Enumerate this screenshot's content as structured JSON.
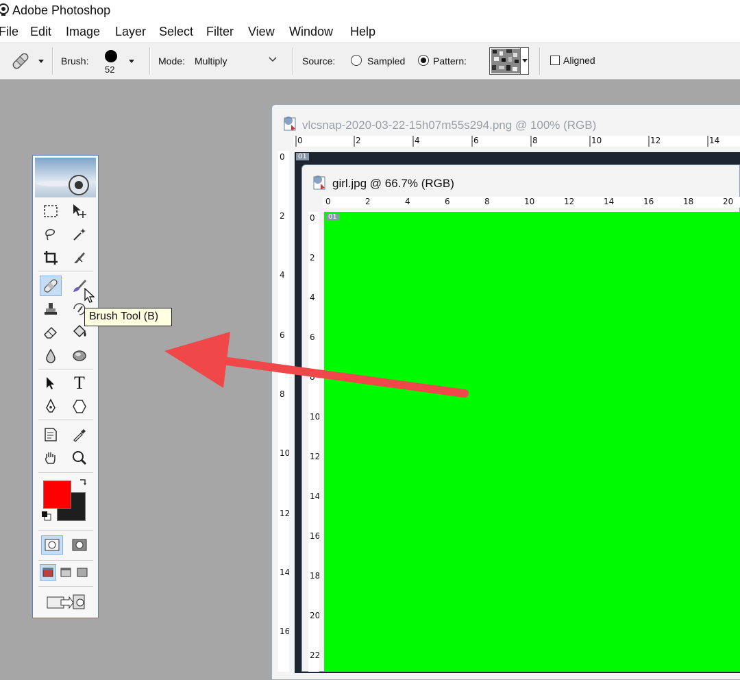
{
  "app": {
    "title": "Adobe Photoshop"
  },
  "menu": [
    "File",
    "Edit",
    "Image",
    "Layer",
    "Select",
    "Filter",
    "View",
    "Window",
    "Help"
  ],
  "options": {
    "brush_label": "Brush:",
    "brush_size": "52",
    "mode_label": "Mode:",
    "mode_value": "Multiply",
    "source_label": "Source:",
    "sampled_label": "Sampled",
    "pattern_label": "Pattern:",
    "source_selected": "Pattern",
    "aligned_label": "Aligned",
    "aligned_checked": false
  },
  "toolbox": {
    "tooltip": "Brush Tool (B)",
    "foreground_color": "#ff0000",
    "background_color": "#1e1e1e"
  },
  "documents": [
    {
      "title": "vlcsnap-2020-03-22-15h07m55s294.png @ 100% (RGB)",
      "layer_tag": "01",
      "ruler_h": [
        "0",
        "2",
        "4",
        "6",
        "8",
        "10",
        "12",
        "14"
      ],
      "ruler_v": [
        "0",
        "2",
        "4",
        "6",
        "8",
        "10",
        "12",
        "14",
        "16"
      ]
    },
    {
      "title": "girl.jpg @ 66.7% (RGB)",
      "layer_tag": "01",
      "ruler_h": [
        "0",
        "2",
        "4",
        "6",
        "8",
        "10",
        "12",
        "14",
        "16",
        "18",
        "20"
      ],
      "ruler_v": [
        "0",
        "2",
        "4",
        "6",
        "8",
        "10",
        "12",
        "14",
        "16",
        "18",
        "20",
        "22"
      ],
      "canvas_color": "#00fb00"
    }
  ],
  "annotation": {
    "arrow_color": "#f04848"
  }
}
